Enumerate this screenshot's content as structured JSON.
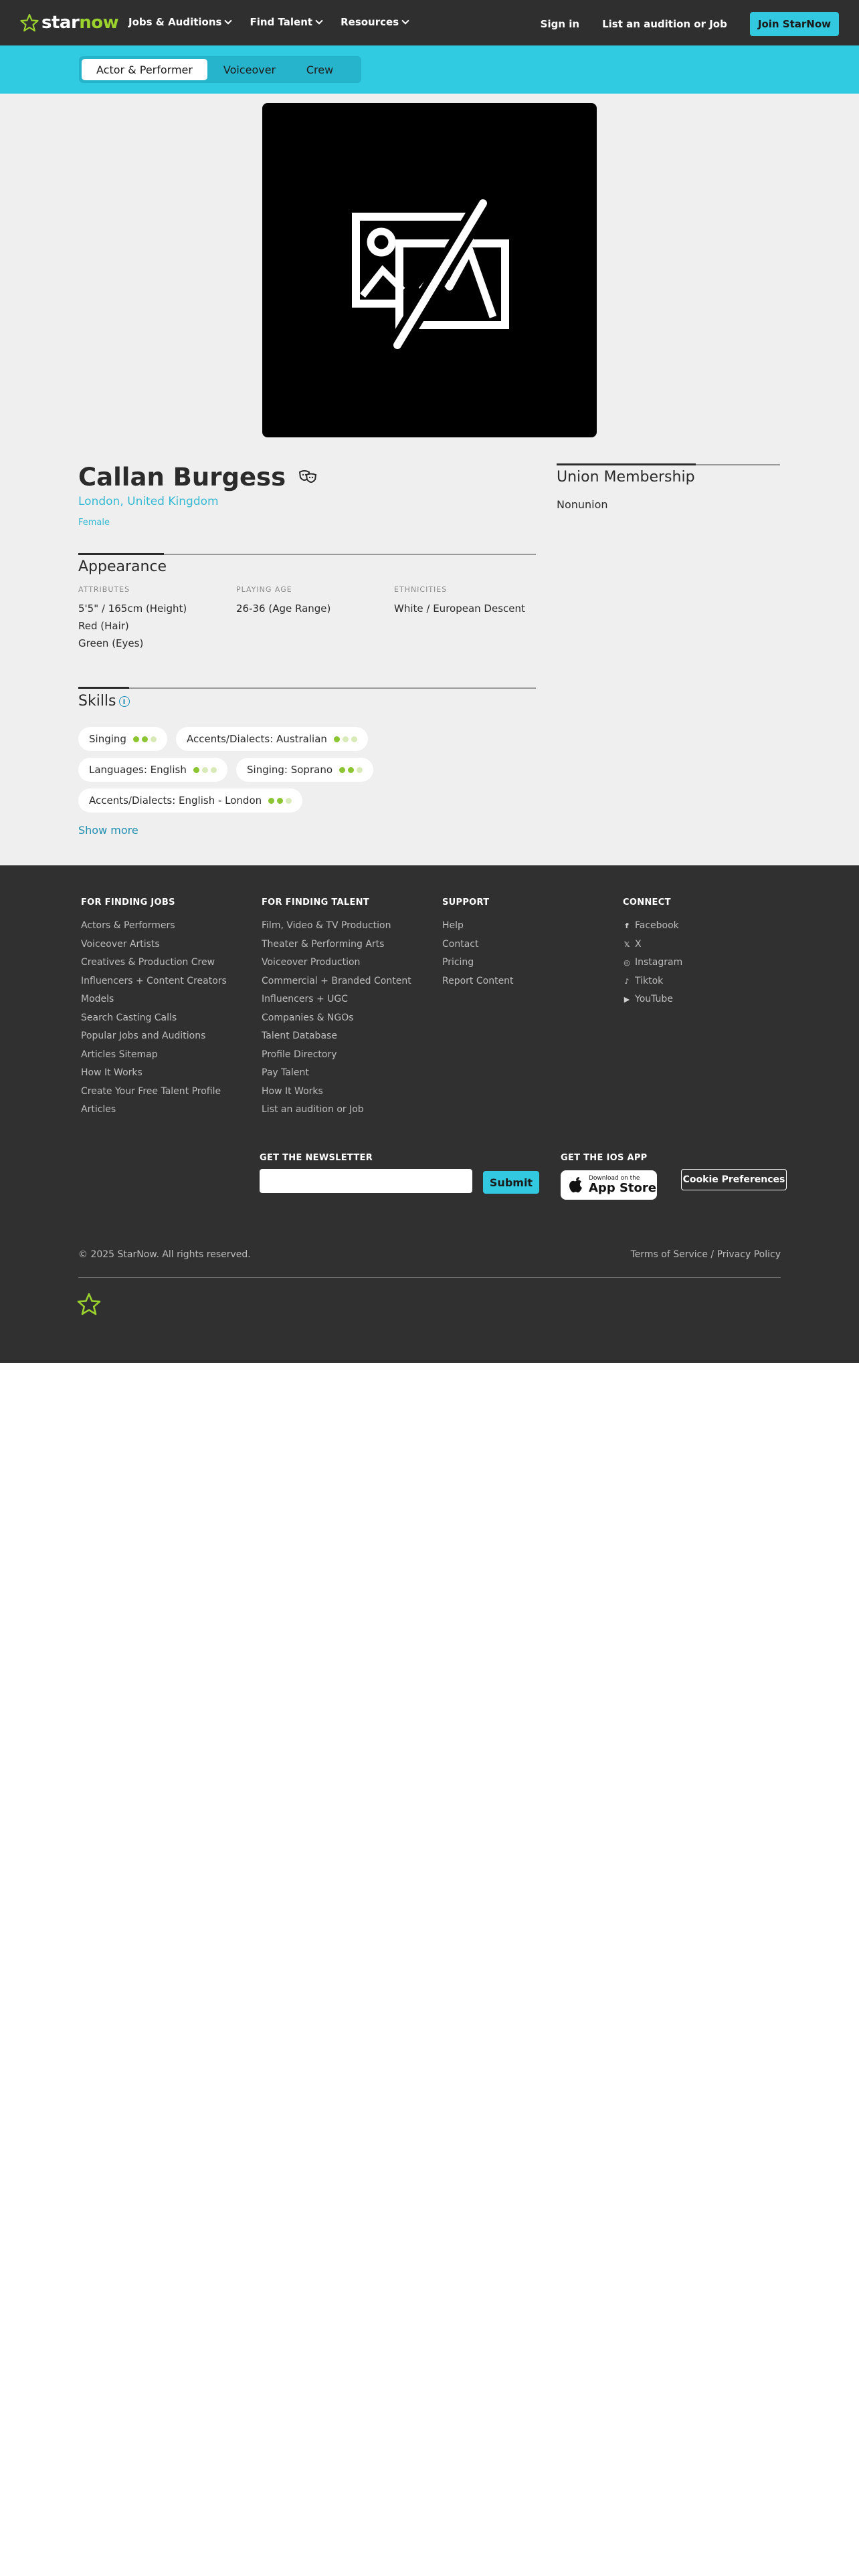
{
  "header": {
    "logo_star": "star",
    "logo_now": "now",
    "nav": [
      "Jobs & Auditions",
      "Find Talent",
      "Resources"
    ],
    "sign_in": "Sign in",
    "list_audition": "List an audition or Job",
    "join": "Join StarNow"
  },
  "tabs": [
    "Actor & Performer",
    "Voiceover",
    "Crew"
  ],
  "profile": {
    "photo_icon": "image-unavailable-icon",
    "name": "Callan Burgess",
    "name_icon": "theater-masks-icon",
    "location": "London, United Kingdom",
    "gender": "Female"
  },
  "appearance": {
    "title": "Appearance",
    "attributes_label": "ATTRIBUTES",
    "attributes": [
      "5'5\" / 165cm (Height)",
      "Red (Hair)",
      "Green (Eyes)"
    ],
    "playing_age_label": "PLAYING AGE",
    "playing_age": "26-36 (Age Range)",
    "ethnicities_label": "ETHNICITIES",
    "ethnicities": "White / European Descent"
  },
  "union": {
    "title": "Union Membership",
    "value": "Nonunion"
  },
  "skills": {
    "title": "Skills",
    "info_icon": "i",
    "items": [
      {
        "label": "Singing",
        "level": 2
      },
      {
        "label": "Accents/Dialects: Australian",
        "level": 1
      },
      {
        "label": "Languages: English",
        "level": 1
      },
      {
        "label": "Singing: Soprano",
        "level": 2
      },
      {
        "label": "Accents/Dialects: English - London",
        "level": 2
      }
    ],
    "show_more": "Show more"
  },
  "footer": {
    "jobs": {
      "title": "FOR FINDING JOBS",
      "links": [
        "Actors & Performers",
        "Voiceover Artists",
        "Creatives & Production Crew",
        "Influencers + Content Creators",
        "Models",
        "Search Casting Calls",
        "Popular Jobs and Auditions",
        "Articles Sitemap",
        "How It Works",
        "Create Your Free Talent Profile",
        "Articles"
      ]
    },
    "talent": {
      "title": "FOR FINDING TALENT",
      "links": [
        "Film, Video & TV Production",
        "Theater & Performing Arts",
        "Voiceover Production",
        "Commercial + Branded Content",
        "Influencers + UGC",
        "Companies & NGOs",
        "Talent Database",
        "Profile Directory",
        "Pay Talent",
        "How It Works",
        "List an audition or Job"
      ]
    },
    "support": {
      "title": "SUPPORT",
      "links": [
        "Help",
        "Contact",
        "Pricing",
        "Report Content"
      ]
    },
    "connect": {
      "title": "CONNECT",
      "links": [
        {
          "label": "Facebook",
          "icon": "f"
        },
        {
          "label": "X",
          "icon": "𝕏"
        },
        {
          "label": "Instagram",
          "icon": "◎"
        },
        {
          "label": "Tiktok",
          "icon": "♪"
        },
        {
          "label": "YouTube",
          "icon": "▶"
        }
      ]
    },
    "newsletter_title": "GET THE NEWSLETTER",
    "submit": "Submit",
    "ios_title": "GET THE IOS APP",
    "appstore_small": "Download on the",
    "appstore_big": "App Store",
    "cookie": "Cookie Preferences",
    "copyright": "© 2025 StarNow. All rights reserved.",
    "terms": "Terms of Service",
    "separator": " / ",
    "privacy": "Privacy Policy"
  },
  "colors": {
    "brand_cyan": "#30cbe0",
    "brand_green": "#9bd22d",
    "header_bg": "#2f2f2f",
    "link_blue": "#1f8eb0"
  }
}
